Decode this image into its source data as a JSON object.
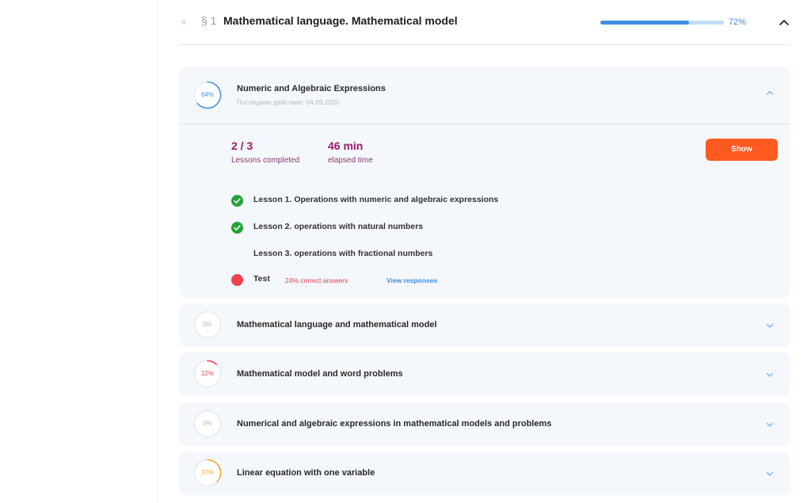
{
  "section": {
    "number": "§ 1",
    "title": "Mathematical language. Mathematical model",
    "progress": 72,
    "progress_label": "72%"
  },
  "topics": [
    {
      "percent": 64,
      "percent_label": "64%",
      "ring_color": "#3f8fe0",
      "title": "Numeric and Algebraic Expressions",
      "last_action": "Последние действия: 04.09.2020",
      "expanded": true,
      "stats": {
        "lessons_value": "2 / 3",
        "lessons_label": "Lessons completed",
        "time_value": "46 min",
        "time_label": "elapsed time"
      },
      "show_label": "Show",
      "lessons": [
        {
          "label": "Lesson 1. Operations with numeric and algebraic expressions",
          "status": "done"
        },
        {
          "label": "Lesson 2. operations with natural numbers",
          "status": "done"
        },
        {
          "label": "Lesson 3. operations with fractional numbers",
          "status": "none"
        }
      ],
      "test": {
        "label": "Test",
        "correct": "24% correct answers",
        "view_responses": "View responses",
        "status": "failed"
      }
    },
    {
      "percent": 0,
      "percent_label": "0%",
      "ring_color": "#c7c7c7",
      "title": "Mathematical language and mathematical model"
    },
    {
      "percent": 12,
      "percent_label": "12%",
      "ring_color": "#e8414f",
      "title": "Mathematical model and word problems"
    },
    {
      "percent": 0,
      "percent_label": "0%",
      "ring_color": "#c7c7c7",
      "title": "Numerical and algebraic expressions in mathematical models and problems"
    },
    {
      "percent": 37,
      "percent_label": "37%",
      "ring_color": "#f5a623",
      "title": "Linear equation with one variable"
    }
  ],
  "colors": {
    "accent_blue": "#3f8fe0",
    "accent_orange": "#ff5a1f",
    "success_green": "#21a336",
    "fail_red": "#e8414f",
    "stat_purple": "#9b1a6e"
  }
}
